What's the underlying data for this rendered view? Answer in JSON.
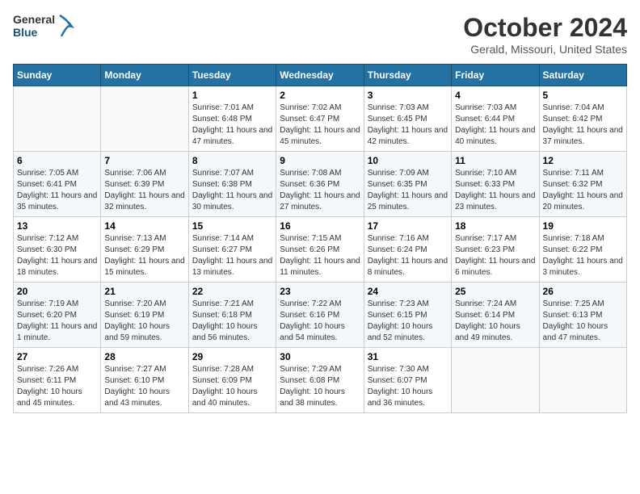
{
  "header": {
    "logo_line1": "General",
    "logo_line2": "Blue",
    "month_title": "October 2024",
    "location": "Gerald, Missouri, United States"
  },
  "days_of_week": [
    "Sunday",
    "Monday",
    "Tuesday",
    "Wednesday",
    "Thursday",
    "Friday",
    "Saturday"
  ],
  "weeks": [
    [
      {
        "day": "",
        "info": ""
      },
      {
        "day": "",
        "info": ""
      },
      {
        "day": "1",
        "info": "Sunrise: 7:01 AM\nSunset: 6:48 PM\nDaylight: 11 hours and 47 minutes."
      },
      {
        "day": "2",
        "info": "Sunrise: 7:02 AM\nSunset: 6:47 PM\nDaylight: 11 hours and 45 minutes."
      },
      {
        "day": "3",
        "info": "Sunrise: 7:03 AM\nSunset: 6:45 PM\nDaylight: 11 hours and 42 minutes."
      },
      {
        "day": "4",
        "info": "Sunrise: 7:03 AM\nSunset: 6:44 PM\nDaylight: 11 hours and 40 minutes."
      },
      {
        "day": "5",
        "info": "Sunrise: 7:04 AM\nSunset: 6:42 PM\nDaylight: 11 hours and 37 minutes."
      }
    ],
    [
      {
        "day": "6",
        "info": "Sunrise: 7:05 AM\nSunset: 6:41 PM\nDaylight: 11 hours and 35 minutes."
      },
      {
        "day": "7",
        "info": "Sunrise: 7:06 AM\nSunset: 6:39 PM\nDaylight: 11 hours and 32 minutes."
      },
      {
        "day": "8",
        "info": "Sunrise: 7:07 AM\nSunset: 6:38 PM\nDaylight: 11 hours and 30 minutes."
      },
      {
        "day": "9",
        "info": "Sunrise: 7:08 AM\nSunset: 6:36 PM\nDaylight: 11 hours and 27 minutes."
      },
      {
        "day": "10",
        "info": "Sunrise: 7:09 AM\nSunset: 6:35 PM\nDaylight: 11 hours and 25 minutes."
      },
      {
        "day": "11",
        "info": "Sunrise: 7:10 AM\nSunset: 6:33 PM\nDaylight: 11 hours and 23 minutes."
      },
      {
        "day": "12",
        "info": "Sunrise: 7:11 AM\nSunset: 6:32 PM\nDaylight: 11 hours and 20 minutes."
      }
    ],
    [
      {
        "day": "13",
        "info": "Sunrise: 7:12 AM\nSunset: 6:30 PM\nDaylight: 11 hours and 18 minutes."
      },
      {
        "day": "14",
        "info": "Sunrise: 7:13 AM\nSunset: 6:29 PM\nDaylight: 11 hours and 15 minutes."
      },
      {
        "day": "15",
        "info": "Sunrise: 7:14 AM\nSunset: 6:27 PM\nDaylight: 11 hours and 13 minutes."
      },
      {
        "day": "16",
        "info": "Sunrise: 7:15 AM\nSunset: 6:26 PM\nDaylight: 11 hours and 11 minutes."
      },
      {
        "day": "17",
        "info": "Sunrise: 7:16 AM\nSunset: 6:24 PM\nDaylight: 11 hours and 8 minutes."
      },
      {
        "day": "18",
        "info": "Sunrise: 7:17 AM\nSunset: 6:23 PM\nDaylight: 11 hours and 6 minutes."
      },
      {
        "day": "19",
        "info": "Sunrise: 7:18 AM\nSunset: 6:22 PM\nDaylight: 11 hours and 3 minutes."
      }
    ],
    [
      {
        "day": "20",
        "info": "Sunrise: 7:19 AM\nSunset: 6:20 PM\nDaylight: 11 hours and 1 minute."
      },
      {
        "day": "21",
        "info": "Sunrise: 7:20 AM\nSunset: 6:19 PM\nDaylight: 10 hours and 59 minutes."
      },
      {
        "day": "22",
        "info": "Sunrise: 7:21 AM\nSunset: 6:18 PM\nDaylight: 10 hours and 56 minutes."
      },
      {
        "day": "23",
        "info": "Sunrise: 7:22 AM\nSunset: 6:16 PM\nDaylight: 10 hours and 54 minutes."
      },
      {
        "day": "24",
        "info": "Sunrise: 7:23 AM\nSunset: 6:15 PM\nDaylight: 10 hours and 52 minutes."
      },
      {
        "day": "25",
        "info": "Sunrise: 7:24 AM\nSunset: 6:14 PM\nDaylight: 10 hours and 49 minutes."
      },
      {
        "day": "26",
        "info": "Sunrise: 7:25 AM\nSunset: 6:13 PM\nDaylight: 10 hours and 47 minutes."
      }
    ],
    [
      {
        "day": "27",
        "info": "Sunrise: 7:26 AM\nSunset: 6:11 PM\nDaylight: 10 hours and 45 minutes."
      },
      {
        "day": "28",
        "info": "Sunrise: 7:27 AM\nSunset: 6:10 PM\nDaylight: 10 hours and 43 minutes."
      },
      {
        "day": "29",
        "info": "Sunrise: 7:28 AM\nSunset: 6:09 PM\nDaylight: 10 hours and 40 minutes."
      },
      {
        "day": "30",
        "info": "Sunrise: 7:29 AM\nSunset: 6:08 PM\nDaylight: 10 hours and 38 minutes."
      },
      {
        "day": "31",
        "info": "Sunrise: 7:30 AM\nSunset: 6:07 PM\nDaylight: 10 hours and 36 minutes."
      },
      {
        "day": "",
        "info": ""
      },
      {
        "day": "",
        "info": ""
      }
    ]
  ]
}
